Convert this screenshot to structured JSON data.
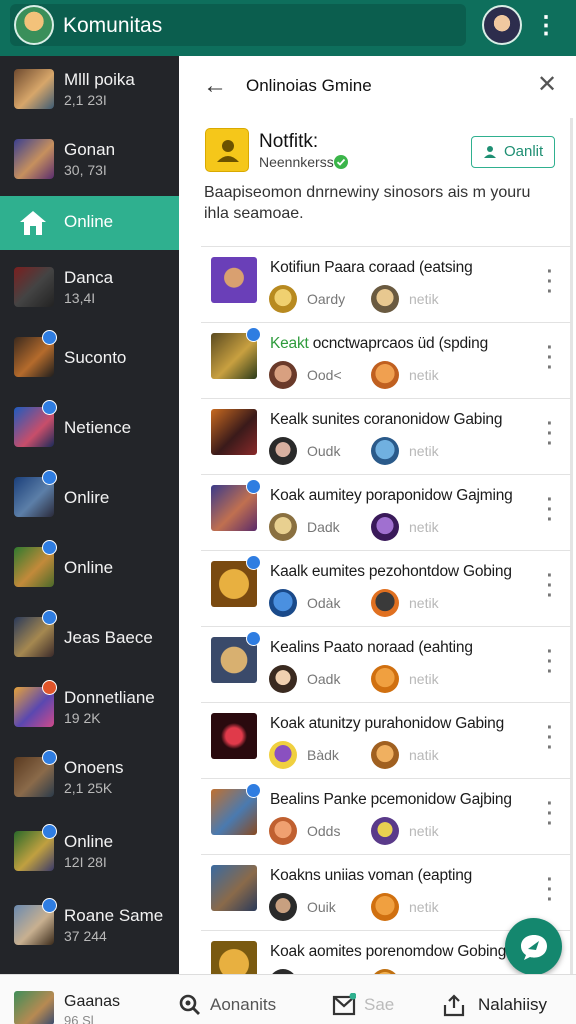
{
  "topbar": {
    "title": "Komunitas"
  },
  "sidebar": {
    "items": [
      {
        "name": "Mlll poika",
        "count": "2,1 23I"
      },
      {
        "name": "Gonan",
        "count": "30, 73I"
      },
      {
        "name": "Online",
        "count": ""
      },
      {
        "name": "Danca",
        "count": "13,4I"
      },
      {
        "name": "Suconto",
        "count": ""
      },
      {
        "name": "Netience",
        "count": ""
      },
      {
        "name": "Onlire",
        "count": ""
      },
      {
        "name": "Online",
        "count": ""
      },
      {
        "name": "Jeas Baece",
        "count": ""
      },
      {
        "name": "Donnetliane",
        "count": "19 2K"
      },
      {
        "name": "Onoens",
        "count": "2,1 25K"
      },
      {
        "name": "Online",
        "count": "12I 28I"
      },
      {
        "name": "Roane Same",
        "count": "37 244"
      }
    ]
  },
  "panel": {
    "title": "Onlinoias Gmine",
    "notification": {
      "title": "Notfitk:",
      "subtitle": "Neennkerss",
      "button_label": "Oanlit",
      "description": "Baapiseomon dnrnewiny sinosors ais m youru ihla seamoae."
    },
    "rows": [
      {
        "title": "Kotifiun Paara coraad (eatsing",
        "l1": "Oardy",
        "l2": "netik"
      },
      {
        "title_prefix": "Keakt",
        "title": " ocnctwaprcaos üd (spding",
        "l1": "Ood<",
        "l2": "netik"
      },
      {
        "title": "Kealk sunites coranonidow Gabing",
        "l1": "Oudk",
        "l2": "netik"
      },
      {
        "title": "Koak aumitey poraponidow Gajming",
        "l1": "Dadk",
        "l2": "netik"
      },
      {
        "title": "Kaalk eumites pezohontdow Gobing",
        "l1": "Odàk",
        "l2": "netik"
      },
      {
        "title": "Kealins Paato noraad (eahting",
        "l1": "Oadk",
        "l2": "netik"
      },
      {
        "title": "Koak atunitzy purahonidow Gabing",
        "l1": "Bàdk",
        "l2": "natik"
      },
      {
        "title": "Bealins Panke pcemonidow Gajbing",
        "l1": "Odds",
        "l2": "netik"
      },
      {
        "title": "Koakns uniias voman (eapting",
        "l1": "Ouik",
        "l2": "netik"
      },
      {
        "title": "Koak aomites porenomdow Gobing",
        "l1": "",
        "l2": ""
      }
    ]
  },
  "bottomnav": {
    "game_title": "Gaanas",
    "game_count": "96 Sl",
    "items": [
      {
        "label": "Aonanits"
      },
      {
        "label": "Sae"
      },
      {
        "label": "Nalahiisy"
      }
    ]
  },
  "colors": {
    "topbar": "#0e6f5c",
    "accent": "#2fb08f",
    "sidebar_bg": "#232529",
    "fab": "#14876e",
    "badge": "#2f7de1"
  },
  "icons": [
    "back-arrow-icon",
    "close-icon",
    "more-vertical-icon",
    "home-icon",
    "person-icon",
    "verified-check-icon",
    "chat-icon",
    "search-icon",
    "mail-icon",
    "share-icon"
  ]
}
